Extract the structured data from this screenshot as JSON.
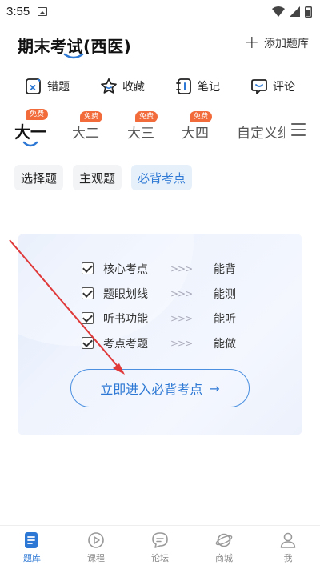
{
  "status_bar": {
    "time": "3:55",
    "icons": [
      "picture-icon",
      "wifi-icon",
      "signal-icon",
      "battery-icon"
    ]
  },
  "header": {
    "title": "期末考试(西医)",
    "add_label": "添加题库"
  },
  "quick_actions": [
    {
      "label": "错题",
      "icon": "wrong-questions-icon"
    },
    {
      "label": "收藏",
      "icon": "star-icon"
    },
    {
      "label": "笔记",
      "icon": "notebook-icon"
    },
    {
      "label": "评论",
      "icon": "comment-icon"
    }
  ],
  "grade_tabs": [
    {
      "label": "大一",
      "badge": "免费",
      "active": true
    },
    {
      "label": "大二",
      "badge": "免费",
      "active": false
    },
    {
      "label": "大三",
      "badge": "免费",
      "active": false
    },
    {
      "label": "大四",
      "badge": "免费",
      "active": false
    },
    {
      "label": "自定义组",
      "badge": "",
      "active": false
    }
  ],
  "sub_tabs": [
    {
      "label": "选择题",
      "active": false
    },
    {
      "label": "主观题",
      "active": false
    },
    {
      "label": "必背考点",
      "active": true
    }
  ],
  "promo": {
    "features": [
      {
        "name": "核心考点",
        "arrows": ">>>",
        "ability": "能背"
      },
      {
        "name": "题眼划线",
        "arrows": ">>>",
        "ability": "能测"
      },
      {
        "name": "听书功能",
        "arrows": ">>>",
        "ability": "能听"
      },
      {
        "name": "考点考题",
        "arrows": ">>>",
        "ability": "能做"
      }
    ],
    "button_label": "立即进入必背考点",
    "button_arrow": "→"
  },
  "bottom_nav": [
    {
      "label": "题库",
      "icon": "question-bank-icon",
      "active": true
    },
    {
      "label": "课程",
      "icon": "play-icon",
      "active": false
    },
    {
      "label": "论坛",
      "icon": "chat-icon",
      "active": false
    },
    {
      "label": "商城",
      "icon": "planet-icon",
      "active": false
    },
    {
      "label": "我",
      "icon": "user-icon",
      "active": false
    }
  ],
  "colors": {
    "accent": "#2d78d4",
    "badge": "#f26b3a",
    "annotation": "#e0393a"
  }
}
